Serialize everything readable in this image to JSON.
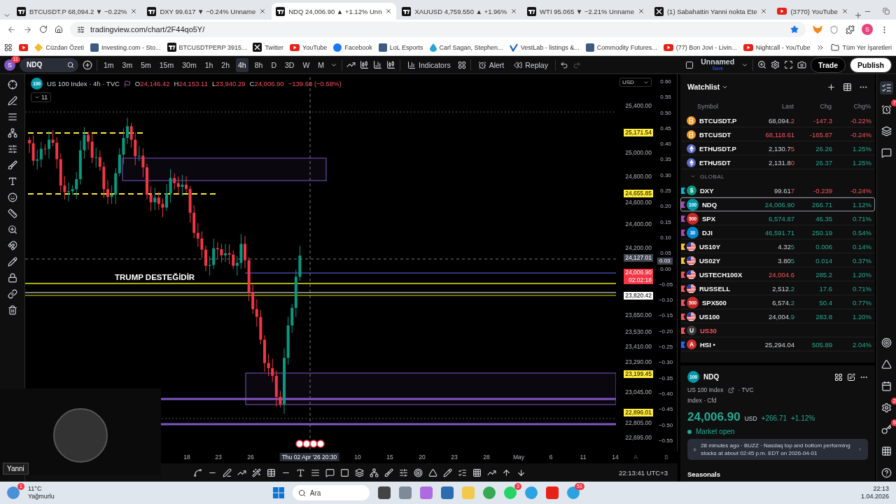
{
  "browser": {
    "tabs": [
      {
        "title": "BTCUSDT.P 68,094.2 ▼ −0.22%",
        "selected": false
      },
      {
        "title": "DXY 99.617 ▼ −0.24% Unname",
        "selected": false
      },
      {
        "title": "NDQ 24,006.90 ▲ +1.12% Unn",
        "selected": true
      },
      {
        "title": "XAUUSD 4,759.550 ▲ +1.96%",
        "selected": false
      },
      {
        "title": "WTI 95.065 ▼ −2.21% Unname",
        "selected": false
      },
      {
        "title": "(1) Sabahattin Yanni nokta Ete",
        "selected": false
      },
      {
        "title": "(3770) YouTube",
        "selected": false
      }
    ],
    "address": "tradingview.com/chart/2F44qo5Y/",
    "profile_initial": "S",
    "bookmarks": [
      "Cüzdan Özeti",
      "Investing.com - Sto...",
      "BTCUSDTPERP 3915...",
      "Twitter",
      "YouTube",
      "Facebook",
      "LoL Esports",
      "Carl Sagan, Stephen...",
      "VestLab - listings &...",
      "Commodity Futures...",
      "(77) Bon Jovi - Livin...",
      "Nightcall - YouTube"
    ],
    "all_bookmarks": "Tüm Yer İşaretleri"
  },
  "toolbar": {
    "avatar": "S",
    "avatar_badge": "11",
    "symbol": "NDQ",
    "intervals": [
      {
        "label": "1m",
        "selected": false
      },
      {
        "label": "3m",
        "selected": false
      },
      {
        "label": "5m",
        "selected": false
      },
      {
        "label": "15m",
        "selected": false
      },
      {
        "label": "30m",
        "selected": false
      },
      {
        "label": "1h",
        "selected": false
      },
      {
        "label": "2h",
        "selected": false
      },
      {
        "label": "4h",
        "selected": true
      },
      {
        "label": "8h",
        "selected": false
      },
      {
        "label": "D",
        "selected": false
      },
      {
        "label": "3D",
        "selected": false
      },
      {
        "label": "W",
        "selected": false
      },
      {
        "label": "M",
        "selected": false
      }
    ],
    "indicators": "Indicators",
    "alert": "Alert",
    "replay": "Replay",
    "layout_name": "Unnamed",
    "save": "Save",
    "trade": "Trade",
    "publish": "Publish"
  },
  "chart": {
    "badge": "100",
    "title": "US 100 Index · 4h · TVC",
    "ohlc": [
      {
        "key": "O",
        "value": "24,146.42"
      },
      {
        "key": "H",
        "value": "24,153.11"
      },
      {
        "key": "L",
        "value": "23,940.29"
      },
      {
        "key": "C",
        "value": "24,006.90"
      }
    ],
    "change": "−139.68 (−0.58%)",
    "indicator_count": "11",
    "annotation": "TRUMP DESTEĞİDİR",
    "currency": "USD",
    "price_axis": [
      {
        "kind": "tick",
        "text": "25,400.00"
      },
      {
        "kind": "yellow",
        "text": "25,171.54"
      },
      {
        "kind": "tick",
        "text": "25,000.00"
      },
      {
        "kind": "tick",
        "text": "24,800.00"
      },
      {
        "kind": "yellow",
        "text": "24,655.85"
      },
      {
        "kind": "tick",
        "text": "24,600.00"
      },
      {
        "kind": "tick",
        "text": "24,400.00"
      },
      {
        "kind": "tick",
        "text": "24,200.00"
      },
      {
        "kind": "gray",
        "text": "24,127.01"
      },
      {
        "kind": "current",
        "text": "24,006.90",
        "sub": "02:02:18"
      },
      {
        "kind": "white",
        "text": "23,820.42"
      },
      {
        "kind": "tick",
        "text": "23,650.00"
      },
      {
        "kind": "tick",
        "text": "23,530.00"
      },
      {
        "kind": "tick",
        "text": "23,410.00"
      },
      {
        "kind": "tick",
        "text": "23,290.00"
      },
      {
        "kind": "yellow",
        "text": "23,199.45"
      },
      {
        "kind": "tick",
        "text": "23,045.00"
      },
      {
        "kind": "yellow",
        "text": "22,896.01"
      },
      {
        "kind": "tick",
        "text": "22,805.00"
      },
      {
        "kind": "tick",
        "text": "22,695.00"
      }
    ],
    "ratio_axis": [
      "0.60",
      "0.55",
      "0.50",
      "0.45",
      "0.40",
      "0.35",
      "0.30",
      "0.25",
      "0.20",
      "0.15",
      "0.10",
      "0.05",
      "0.00",
      "−0.05",
      "−0.10",
      "−0.15",
      "−0.20",
      "−0.25",
      "−0.30",
      "−0.35",
      "−0.40",
      "−0.45",
      "−0.50",
      "−0.55"
    ],
    "ratio_marker": "0.03",
    "time_axis": [
      {
        "text": "18",
        "selected": false
      },
      {
        "text": "23",
        "selected": false
      },
      {
        "text": "26",
        "selected": false
      },
      {
        "text": "Thu 02 Apr '26   20:30",
        "selected": true
      },
      {
        "text": "10",
        "selected": false
      },
      {
        "text": "15",
        "selected": false
      },
      {
        "text": "20",
        "selected": false
      },
      {
        "text": "23",
        "selected": false
      },
      {
        "text": "28",
        "selected": false
      },
      {
        "text": "May",
        "selected": false
      },
      {
        "text": "6",
        "selected": false
      },
      {
        "text": "11",
        "selected": false
      },
      {
        "text": "14",
        "selected": false
      }
    ],
    "axis_buttons": [
      "A",
      "B"
    ],
    "clock": "22:13:41 UTC+3",
    "webcam_name": "Yanni"
  },
  "watchlist": {
    "title": "Watchlist",
    "columns": [
      "Symbol",
      "Last",
      "Chg",
      "Chg%"
    ],
    "rows": [
      {
        "kind": "item",
        "icon": {
          "kind": "bitcoin",
          "color": "#f7931a"
        },
        "symbol": "BTCUSDT.P",
        "last": "68,094.",
        "last_tail": "2",
        "tick_up": false,
        "last_highlight": false,
        "chg": "-147.3",
        "chg_pct": "-0.22%",
        "rising": false,
        "available": true,
        "selected": false
      },
      {
        "kind": "item",
        "icon": {
          "kind": "bitcoin",
          "color": "#f7931a"
        },
        "symbol": "BTCUSDT",
        "last": "68,118.6",
        "last_tail": "1",
        "tick_up": false,
        "last_highlight": true,
        "chg": "-165.87",
        "chg_pct": "-0.24%",
        "rising": false,
        "available": true,
        "selected": false
      },
      {
        "kind": "item",
        "icon": {
          "kind": "ethereum",
          "color": "#5c6bc0"
        },
        "symbol": "ETHUSDT.P",
        "last": "2,130.7",
        "last_tail": "5",
        "tick_up": false,
        "last_highlight": false,
        "chg": "26.26",
        "chg_pct": "1.25%",
        "rising": true,
        "available": true,
        "selected": false
      },
      {
        "kind": "item",
        "icon": {
          "kind": "ethereum",
          "color": "#5c6bc0"
        },
        "symbol": "ETHUSDT",
        "last": "2,131.8",
        "last_tail": "0",
        "tick_up": false,
        "last_highlight": false,
        "chg": "26.37",
        "chg_pct": "1.25%",
        "rising": true,
        "available": true,
        "selected": false
      },
      {
        "kind": "section",
        "label": "GLOBAL",
        "expanded": true
      },
      {
        "kind": "item",
        "color": "#00bcd4",
        "icon": {
          "kind": "badge",
          "text": "$",
          "color": "#089981"
        },
        "symbol": "DXY",
        "last": "99.61",
        "last_tail": "7",
        "tick_up": false,
        "last_highlight": false,
        "chg": "-0.239",
        "chg_pct": "-0.24%",
        "rising": false,
        "available": true,
        "selected": false
      },
      {
        "kind": "item",
        "color": "#ab47bc",
        "icon": {
          "kind": "badge",
          "text": "100",
          "color": "#0097a7"
        },
        "symbol": "NDQ",
        "last": "24,006.9",
        "last_tail": "0",
        "tick_up": true,
        "last_highlight": true,
        "chg": "266.71",
        "chg_pct": "1.12%",
        "rising": true,
        "available": true,
        "selected": true
      },
      {
        "kind": "item",
        "color": "#ab47bc",
        "icon": {
          "kind": "badge",
          "text": "500",
          "color": "#c62828"
        },
        "symbol": "SPX",
        "last": "6,574.8",
        "last_tail": "7",
        "tick_up": true,
        "last_highlight": true,
        "chg": "46.35",
        "chg_pct": "0.71%",
        "rising": true,
        "available": true,
        "selected": false
      },
      {
        "kind": "item",
        "color": "#ab47bc",
        "icon": {
          "kind": "badge",
          "text": "30",
          "color": "#0288d1"
        },
        "symbol": "DJI",
        "last": "46,591.7",
        "last_tail": "1",
        "tick_up": true,
        "last_highlight": true,
        "chg": "250.19",
        "chg_pct": "0.54%",
        "rising": true,
        "available": true,
        "selected": false
      },
      {
        "kind": "item",
        "color": "#fbc02d",
        "icon": {
          "kind": "us-flag"
        },
        "symbol": "US10Y",
        "last": "4.32",
        "last_tail": "5",
        "tick_up": true,
        "last_highlight": false,
        "chg": "0.006",
        "chg_pct": "0.14%",
        "rising": true,
        "available": true,
        "selected": false
      },
      {
        "kind": "item",
        "color": "#fbc02d",
        "icon": {
          "kind": "us-flag"
        },
        "symbol": "US02Y",
        "last": "3.80",
        "last_tail": "5",
        "tick_up": true,
        "last_highlight": false,
        "chg": "0.014",
        "chg_pct": "0.37%",
        "rising": true,
        "available": true,
        "selected": false
      },
      {
        "kind": "item",
        "color": "#f7525f",
        "icon": {
          "kind": "us-flag"
        },
        "symbol": "USTECH100X",
        "last": "24,004.",
        "last_tail": "6",
        "tick_up": false,
        "last_highlight": true,
        "chg": "285.2",
        "chg_pct": "1.20%",
        "rising": true,
        "available": true,
        "selected": false
      },
      {
        "kind": "item",
        "color": "#f7525f",
        "icon": {
          "kind": "us-flag"
        },
        "symbol": "RUSSELL",
        "last": "2,512.",
        "last_tail": "2",
        "tick_up": true,
        "last_highlight": false,
        "chg": "17.6",
        "chg_pct": "0.71%",
        "rising": true,
        "available": true,
        "selected": false
      },
      {
        "kind": "item",
        "color": "#f7525f",
        "icon": {
          "kind": "badge",
          "text": "500",
          "color": "#c62828"
        },
        "symbol": "SPX500",
        "last": "6,574.",
        "last_tail": "2",
        "tick_up": true,
        "last_highlight": false,
        "chg": "50.4",
        "chg_pct": "0.77%",
        "rising": true,
        "available": true,
        "selected": false
      },
      {
        "kind": "item",
        "color": "#f7525f",
        "icon": {
          "kind": "us-flag"
        },
        "symbol": "US100",
        "last": "24,004.",
        "last_tail": "9",
        "tick_up": true,
        "last_highlight": false,
        "chg": "283.8",
        "chg_pct": "1.20%",
        "rising": true,
        "available": true,
        "selected": false
      },
      {
        "kind": "item",
        "color": "#f7525f",
        "icon": {
          "kind": "badge",
          "text": "U",
          "color": "#3a3a3a"
        },
        "symbol": "US30",
        "available": false,
        "selected": false
      },
      {
        "kind": "item",
        "color": "#2962ff",
        "icon": {
          "kind": "badge",
          "text": "A",
          "color": "#d32f2f"
        },
        "symbol": "HSI •",
        "last": "25,294.04",
        "last_highlight": false,
        "chg": "505.89",
        "chg_pct": "2.04%",
        "rising": true,
        "available": true,
        "selected": false
      }
    ]
  },
  "details": {
    "badge": "100",
    "symbol": "NDQ",
    "name": "US 100 Index",
    "exchange": "· TVC",
    "type_line": "Index · Cfd",
    "price": "24,006.90",
    "currency": "USD",
    "change": "+266.71",
    "change_pct": "+1.12%",
    "status": "Market open",
    "news": "28 minutes ago · BUZZ · Nasdaq top and bottom performing stocks at about 02:45 p.m. EDT on 2026-04-01",
    "seasonals": "Seasonals"
  },
  "sidebar_badges": {
    "rewards": "2",
    "keys": "5",
    "alerts": "7"
  },
  "taskbar": {
    "weather_badge": "1",
    "temperature": "11°C",
    "condition": "Yağmurlu",
    "search": "Ara",
    "whatsapp_badge": "3",
    "telegram_badge": "51",
    "time": "22:13",
    "date": "1.04.2026"
  }
}
